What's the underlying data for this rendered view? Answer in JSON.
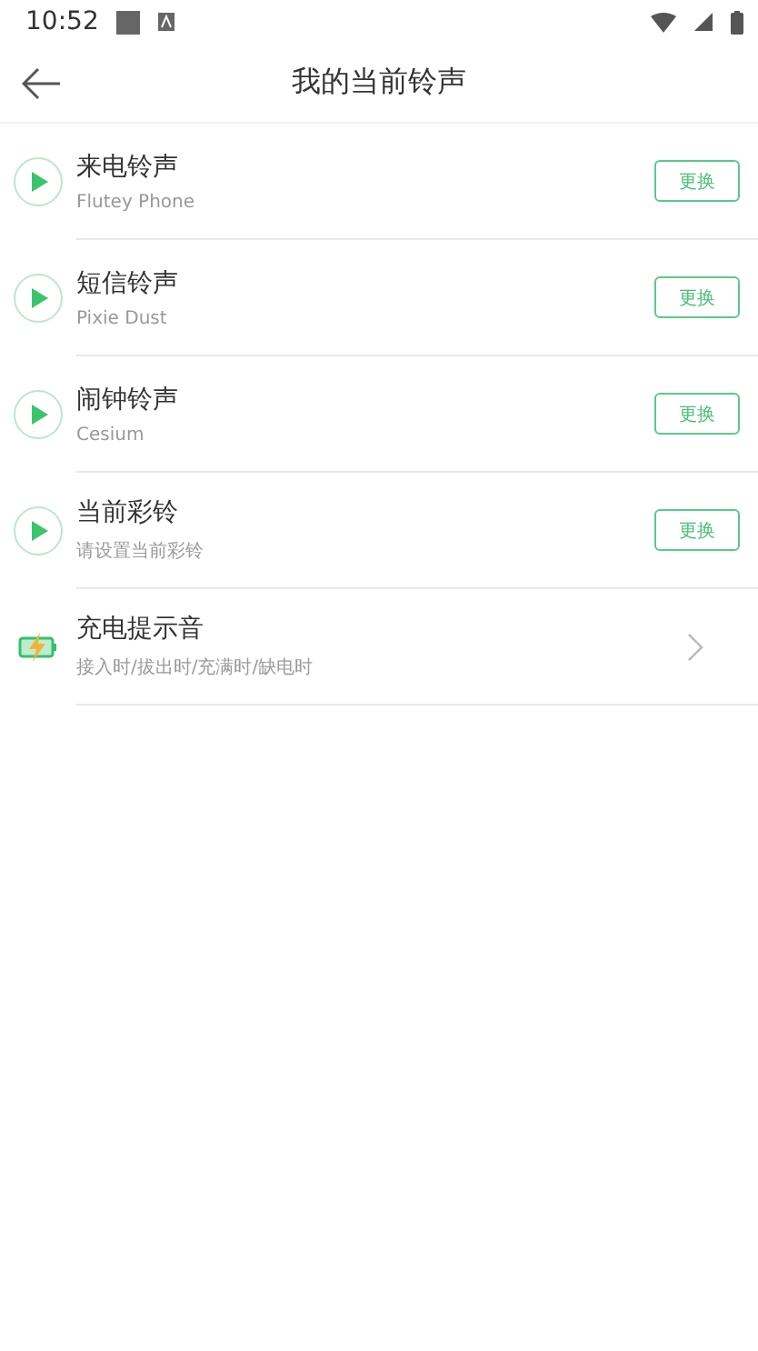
{
  "status_bar": {
    "time": "10:52"
  },
  "header": {
    "title": "我的当前铃声"
  },
  "rows": [
    {
      "kind": "ringtone",
      "title": "来电铃声",
      "subtitle": "Flutey Phone",
      "action": "更换"
    },
    {
      "kind": "ringtone",
      "title": "短信铃声",
      "subtitle": "Pixie Dust",
      "action": "更换"
    },
    {
      "kind": "ringtone",
      "title": "闹钟铃声",
      "subtitle": "Cesium",
      "action": "更换"
    },
    {
      "kind": "ringtone",
      "title": "当前彩铃",
      "subtitle": "请设置当前彩铃",
      "action": "更换"
    },
    {
      "kind": "charging",
      "title": "充电提示音",
      "subtitle": "接入时/拔出时/充满时/缺电时"
    }
  ]
}
